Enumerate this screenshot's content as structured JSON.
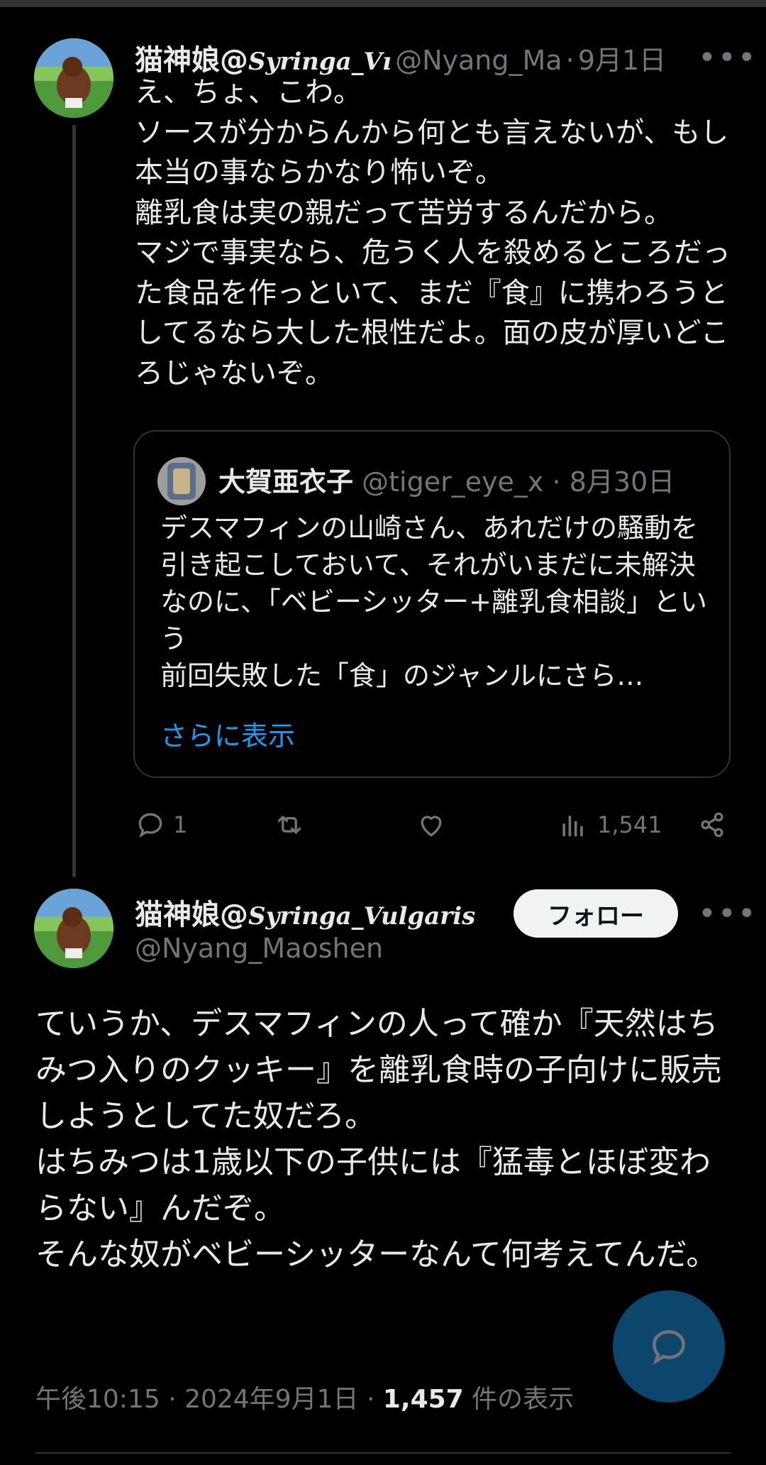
{
  "tweet1": {
    "display_name": "猫神娘@",
    "display_name_script": "Syringa_Vı",
    "handle": "@Nyang_Ma",
    "date": "9月1日",
    "text": "え、ちょ、こわ。\nソースが分からんから何とも言えないが、もし本当の事ならかなり怖いぞ。\n離乳食は実の親だって苦労するんだから。\nマジで事実なら、危うく人を殺めるところだった食品を作っといて、まだ『食』に携わろうとしてるなら大した根性だよ。面の皮が厚いどころじゃないぞ。"
  },
  "quote": {
    "display_name": "大賀亜衣子",
    "handle": "@tiger_eye_x",
    "date": "8月30日",
    "text": "デスマフィンの山崎さん、あれだけの騒動を引き起こしておいて、それがいまだに未解決なのに、「ベビーシッター+離乳食相談」という\n前回失敗した「食」のジャンルにさら…",
    "show_more": "さらに表示"
  },
  "actions": {
    "replies": "1",
    "views": "1,541"
  },
  "tweet2": {
    "display_name": "猫神娘@",
    "display_name_script": "Syringa_Vulgaris",
    "handle": "@Nyang_Maoshen",
    "follow_label": "フォロー",
    "text": "ていうか、デスマフィンの人って確か『天然はちみつ入りのクッキー』を離乳食時の子向けに販売しようとしてた奴だろ。\nはちみつは1歳以下の子供には『猛毒とほぼ変わらない』んだぞ。\nそんな奴がベビーシッターなんて何考えてんだ。",
    "time": "午後10:15 · 2024年9月1日 · ",
    "view_count": "1,457",
    "view_label": " 件の表示"
  },
  "colors": {
    "background": "#000000",
    "text": "#e7e9ea",
    "muted": "#71767b",
    "accent": "#1d9bf0"
  }
}
